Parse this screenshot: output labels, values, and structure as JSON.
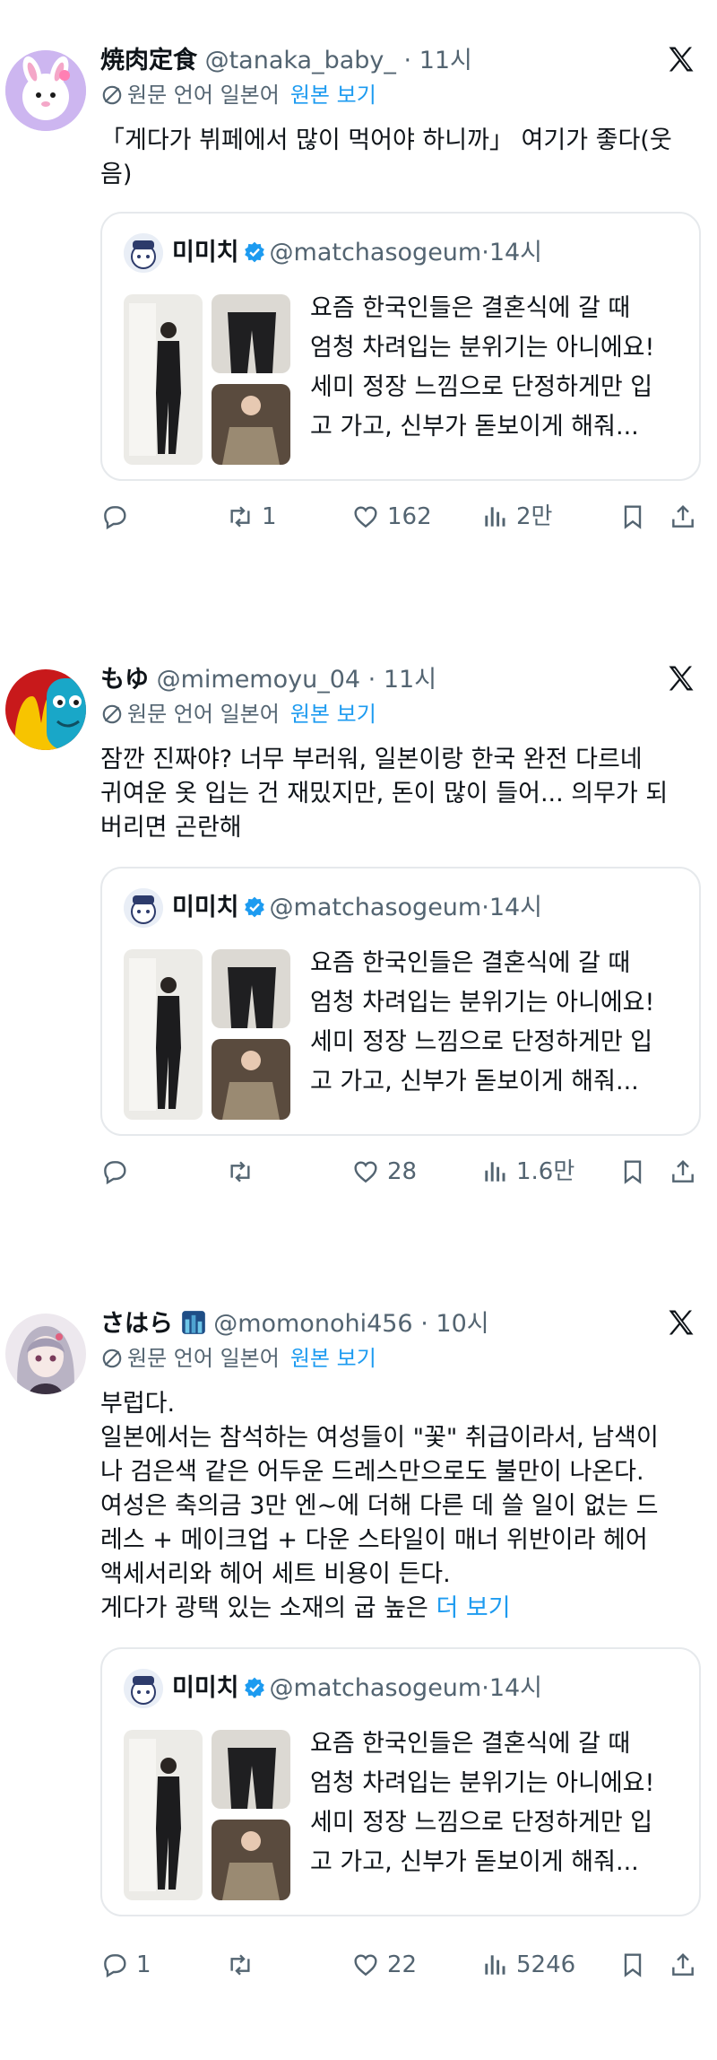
{
  "translate": {
    "label": "원문 언어 일본어",
    "show_original": "원본 보기"
  },
  "quoted_tweet": {
    "name": "미미치",
    "handle": "@matchasogeum",
    "time": "14시",
    "lines": [
      "요즘 한국인들은 결혼식에 갈 때",
      "엄청 차려입는 분위기는 아니에요!",
      "세미 정장 느낌으로 단정하게만 입",
      "고 가고, 신부가 돋보이게 해줘..."
    ]
  },
  "tweets": [
    {
      "name": "焼肉定食",
      "handle": "@tanaka_baby_",
      "time": "11시",
      "lines": [
        "「게다가 뷔페에서 많이 먹어야 하니까」 여기가 좋다(웃",
        "음)"
      ],
      "actions": {
        "reply": "",
        "retweet": "1",
        "like": "162",
        "views": "2만"
      }
    },
    {
      "name": "もゆ",
      "handle": "@mimemoyu_04",
      "time": "11시",
      "lines": [
        "잠깐 진짜야? 너무 부러워, 일본이랑 한국 완전 다르네",
        "귀여운 옷 입는 건 재밌지만, 돈이 많이 들어... 의무가 되",
        "버리면 곤란해"
      ],
      "actions": {
        "reply": "",
        "retweet": "",
        "like": "28",
        "views": "1.6만"
      }
    },
    {
      "name": "さはら",
      "handle": "@momonohi456",
      "time": "10시",
      "lines": [
        "부럽다.",
        "일본에서는 참석하는 여성들이 \"꽃\" 취급이라서, 남색이",
        "나 검은색 같은 어두운 드레스만으로도 불만이 나온다.",
        "여성은 축의금 3만 엔~에 더해 다른 데 쓸 일이 없는 드",
        "레스 + 메이크업 + 다운 스타일이 매너 위반이라 헤어",
        "액세서리와 헤어 세트 비용이 든다.",
        "게다가 광택 있는 소재의 굽 높은"
      ],
      "more": "더 보기",
      "actions": {
        "reply": "1",
        "retweet": "",
        "like": "22",
        "views": "5246"
      }
    }
  ],
  "colors": {
    "text": "#0f1419",
    "secondary": "#536471",
    "link": "#1d9bf0",
    "verified": "#1d9bf0",
    "border": "#e6e9ec"
  },
  "icons": {
    "brand": "x-logo-icon",
    "translate": "globe-slash-icon",
    "verified": "verified-badge-icon",
    "reply": "reply-icon",
    "retweet": "retweet-icon",
    "like": "heart-icon",
    "views": "views-icon",
    "bookmark": "bookmark-icon",
    "share": "share-icon"
  }
}
